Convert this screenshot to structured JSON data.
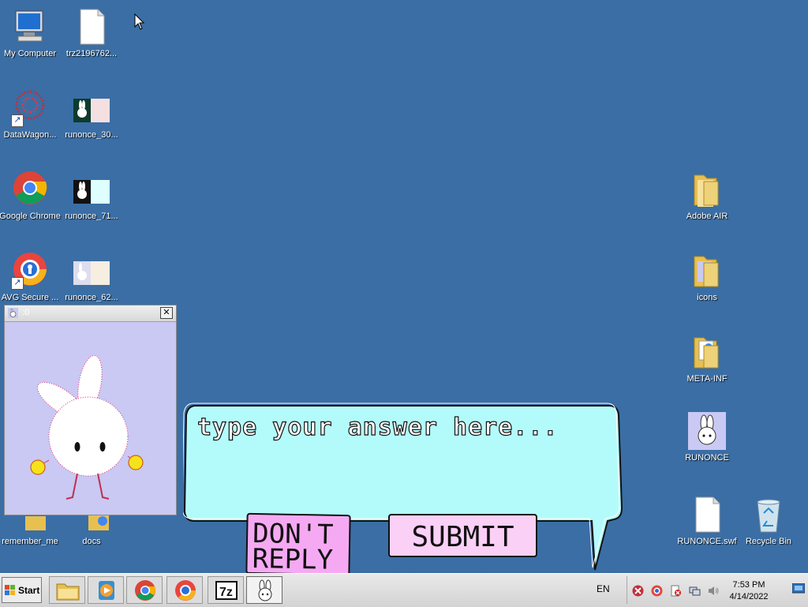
{
  "desktop": {
    "icons_left": [
      {
        "label": "My Computer",
        "icon": "computer-icon"
      },
      {
        "label": "trz2196762...",
        "icon": "file-icon"
      },
      {
        "label": "DataWagon...",
        "icon": "datawagon-icon"
      },
      {
        "label": "runonce_30...",
        "icon": "image-thumbnail-icon"
      },
      {
        "label": "Google Chrome",
        "icon": "chrome-icon"
      },
      {
        "label": "runonce_71...",
        "icon": "image-thumbnail-icon"
      },
      {
        "label": "AVG Secure ...",
        "icon": "avg-browser-icon"
      },
      {
        "label": "runonce_62...",
        "icon": "image-thumbnail-icon"
      },
      {
        "label": "remember_me",
        "icon": "folder-icon"
      },
      {
        "label": "docs",
        "icon": "chrome-folder-icon"
      }
    ],
    "icons_right": [
      {
        "label": "Adobe AIR",
        "icon": "folder-icon"
      },
      {
        "label": "icons",
        "icon": "folder-icon"
      },
      {
        "label": "META-INF",
        "icon": "folder-icon"
      },
      {
        "label": "RUNONCE",
        "icon": "bunny-app-icon"
      },
      {
        "label": "RUNONCE.swf",
        "icon": "file-icon"
      },
      {
        "label": "Recycle Bin",
        "icon": "recycle-bin-icon"
      }
    ]
  },
  "popup": {
    "title": ":0"
  },
  "dialog": {
    "answer_placeholder": "type your answer here...",
    "dont_reply_label": "DON'T REPLY",
    "submit_label": "SUBMIT",
    "bubble_color": "#b3fbfb",
    "button_color": "#f6a9f3"
  },
  "taskbar": {
    "start_label": "Start",
    "apps": [
      "file-explorer-icon",
      "media-player-icon",
      "chrome-icon",
      "avg-browser-icon",
      "7zip-icon",
      "bunny-app-icon"
    ],
    "language": "EN",
    "time": "7:53 PM",
    "date": "4/14/2022"
  }
}
